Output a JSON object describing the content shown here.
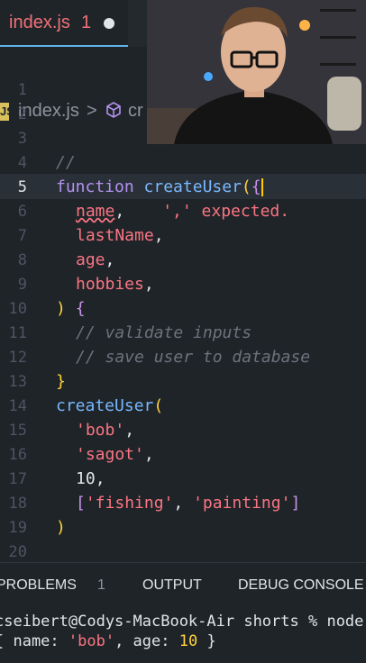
{
  "tab": {
    "label": "index.js",
    "count": "1"
  },
  "breadcrumb": {
    "file_icon": "JS",
    "file": "index.js",
    "separator": ">",
    "function": "cr"
  },
  "gutter": [
    "1",
    "2",
    "3",
    "4",
    "5",
    "6",
    "7",
    "8",
    "9",
    "10",
    "11",
    "12",
    "13",
    "14",
    "15",
    "16",
    "17",
    "18",
    "19",
    "20"
  ],
  "code": {
    "l4": "//",
    "l5_kw": "function",
    "l5_fn": "createUser",
    "l5_paren": "(",
    "l5_brace": "{",
    "l6_param": "name",
    "l6_comma": ",",
    "l6_error": "',' expected.",
    "l7_param": "lastName",
    "l7_comma": ",",
    "l8_param": "age",
    "l8_comma": ",",
    "l9_param": "hobbies",
    "l9_comma": ",",
    "l10_paren": ")",
    "l10_brace": "{",
    "l11": "// validate inputs",
    "l12": "// save user to database",
    "l13": "}",
    "l14_fn": "createUser",
    "l14_paren": "(",
    "l15": "'bob'",
    "l15_comma": ",",
    "l16": "'sagot'",
    "l16_comma": ",",
    "l17": "10",
    "l17_comma": ",",
    "l18_open": "[",
    "l18_a": "'fishing'",
    "l18_sep": ", ",
    "l18_b": "'painting'",
    "l18_close": "]",
    "l19": ")"
  },
  "panel": {
    "problems": "PROBLEMS",
    "problems_count": "1",
    "output": "OUTPUT",
    "debug": "DEBUG CONSOLE"
  },
  "terminal": {
    "line1": "cseibert@Codys-MacBook-Air shorts % node",
    "line2_open": "{ name: ",
    "line2_name": "'bob'",
    "line2_mid": ", age: ",
    "line2_age": "10",
    "line2_close": " }"
  },
  "colors": {
    "accent": "#5fb3e9",
    "error": "#f97583",
    "keyword": "#b392f0",
    "function": "#79b8ff"
  }
}
